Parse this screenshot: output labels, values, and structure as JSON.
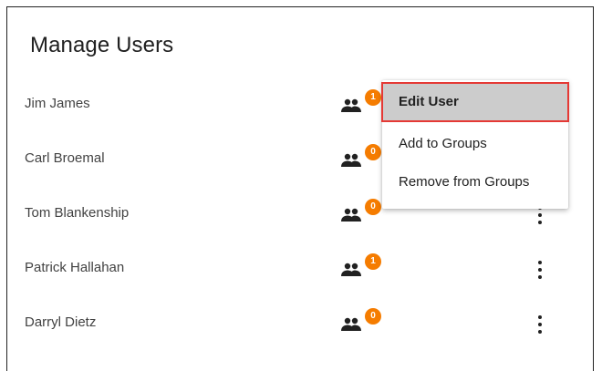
{
  "page": {
    "title": "Manage Users"
  },
  "users": [
    {
      "name": "Jim James",
      "group_count": "1"
    },
    {
      "name": "Carl Broemal",
      "group_count": "0"
    },
    {
      "name": "Tom Blankenship",
      "group_count": "0"
    },
    {
      "name": "Patrick Hallahan",
      "group_count": "1"
    },
    {
      "name": "Darryl Dietz",
      "group_count": "0"
    }
  ],
  "context_menu": {
    "items": [
      {
        "label": "Edit User",
        "highlighted": true
      },
      {
        "label": "Add to Groups",
        "highlighted": false
      },
      {
        "label": "Remove from Groups",
        "highlighted": false
      }
    ]
  },
  "icons": {
    "group": "group-icon",
    "more": "more-vertical-icon"
  },
  "colors": {
    "badge": "#f57c00",
    "highlight_border": "#e53935",
    "highlight_bg": "#cccccc"
  }
}
